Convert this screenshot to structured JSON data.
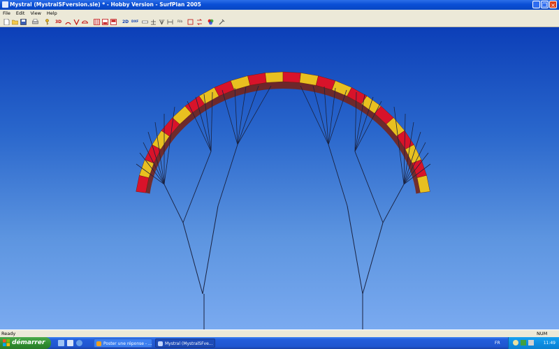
{
  "window": {
    "title": "Mystral (MystralSFversion.sle) * - Hobby Version - SurfPlan 2005",
    "controls": [
      "minimize-icon",
      "maximize-icon",
      "close-icon"
    ]
  },
  "menu": [
    "File",
    "Edit",
    "View",
    "Help"
  ],
  "toolbar": {
    "label_3d": "3D",
    "label_2d": "2D",
    "label_dxf": "DXF",
    "label_rib": "Rib"
  },
  "canvas": {
    "background_top": "#0c3fb8",
    "background_bottom": "#7aaaf0",
    "canopy_colors": [
      "#d8132a",
      "#e8c020"
    ]
  },
  "status": {
    "left": "Ready",
    "right": "NUM"
  },
  "taskbar": {
    "start_label": "démarrer",
    "tasks": [
      {
        "label": "Poster une réponse - ...",
        "active": false
      },
      {
        "label": "Mystral (MystralSFve...",
        "active": true
      }
    ],
    "language": "FR",
    "clock": "11:49"
  }
}
